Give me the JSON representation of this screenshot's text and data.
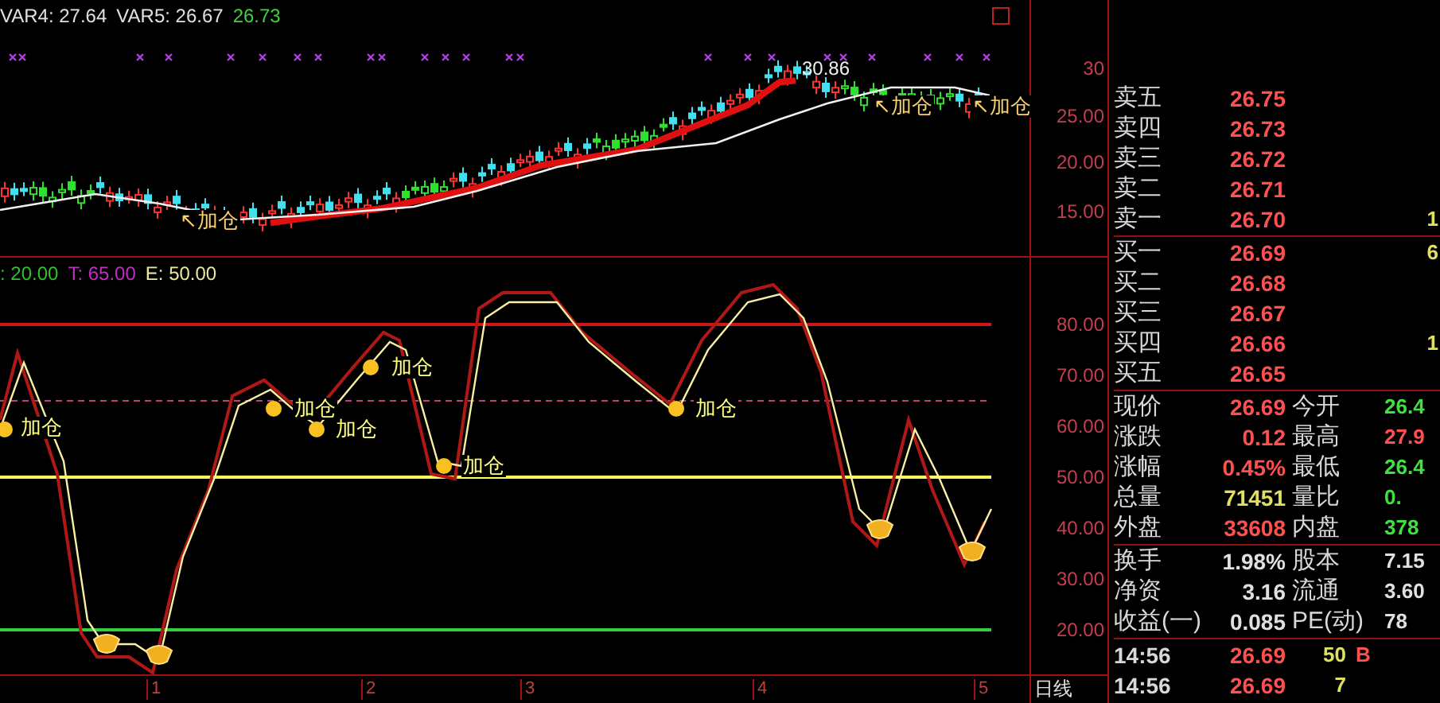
{
  "upper_chart": {
    "legend": [
      {
        "text": "VAR4: 27.64",
        "color": "#e0e0e0"
      },
      {
        "text": "VAR5: 26.67",
        "color": "#e0e0e0"
      },
      {
        "text": "26.73",
        "color": "#40d040"
      }
    ],
    "signals": [
      {
        "label": "↖加仓"
      },
      {
        "label": "↖加仓"
      },
      {
        "label": "↖加仓"
      }
    ],
    "high_label": "30.86",
    "axis_labels": [
      "30",
      "25.00",
      "20.00",
      "15.00"
    ]
  },
  "lower_chart": {
    "legend": [
      {
        "text": ": 20.00",
        "color": "#30c030"
      },
      {
        "text": "T: 65.00",
        "color": "#c030c0"
      },
      {
        "text": "E: 50.00",
        "color": "#e8e8a0"
      }
    ],
    "signals": [
      {
        "label": "加仓"
      },
      {
        "label": "加仓"
      },
      {
        "label": "加仓"
      },
      {
        "label": "加仓"
      },
      {
        "label": "加仓"
      },
      {
        "label": "加仓"
      }
    ],
    "axis_labels": [
      "80.00",
      "70.00",
      "60.00",
      "50.00",
      "40.00",
      "30.00",
      "20.00"
    ]
  },
  "x_axis": {
    "labels": [
      "1",
      "2",
      "3",
      "4",
      "5"
    ],
    "period": "日线"
  },
  "order_book": {
    "asks": [
      {
        "label": "卖五",
        "price": "26.75"
      },
      {
        "label": "卖四",
        "price": "26.73"
      },
      {
        "label": "卖三",
        "price": "26.72"
      },
      {
        "label": "卖二",
        "price": "26.71"
      },
      {
        "label": "卖一",
        "price": "26.70",
        "volume": "1"
      }
    ],
    "bids": [
      {
        "label": "买一",
        "price": "26.69",
        "volume": "6"
      },
      {
        "label": "买二",
        "price": "26.68"
      },
      {
        "label": "买三",
        "price": "26.67"
      },
      {
        "label": "买四",
        "price": "26.66",
        "volume": "1"
      },
      {
        "label": "买五",
        "price": "26.65"
      }
    ]
  },
  "quote_stats": [
    {
      "label": "现价",
      "value": "26.69",
      "kind": "rise"
    },
    {
      "label": "今开",
      "value": "26.4",
      "kind": "fall"
    },
    {
      "label": "涨跌",
      "value": "0.12",
      "kind": "rise"
    },
    {
      "label": "最高",
      "value": "27.9",
      "kind": "rise"
    },
    {
      "label": "涨幅",
      "value": "0.45%",
      "kind": "rise"
    },
    {
      "label": "最低",
      "value": "26.4",
      "kind": "fall"
    },
    {
      "label": "总量",
      "value": "71451",
      "kind": "volume"
    },
    {
      "label": "量比",
      "value": "0.",
      "kind": "fall"
    },
    {
      "label": "外盘",
      "value": "33608",
      "kind": "rise"
    },
    {
      "label": "内盘",
      "value": "378",
      "kind": "fall"
    }
  ],
  "finance_stats": [
    {
      "label": "换手",
      "value": "1.98%",
      "kind": "flat"
    },
    {
      "label": "股本",
      "value": "7.15",
      "kind": "flat"
    },
    {
      "label": "净资",
      "value": "3.16",
      "kind": "flat"
    },
    {
      "label": "流通",
      "value": "3.60",
      "kind": "flat"
    },
    {
      "label": "收益(一)",
      "value": "0.085",
      "kind": "flat"
    },
    {
      "label": "PE(动)",
      "value": "78",
      "kind": "flat"
    }
  ],
  "ticks": [
    {
      "time": "14:56",
      "price": "26.69",
      "volume": "50",
      "side": "B"
    },
    {
      "time": "14:56",
      "price": "26.69",
      "volume": "7"
    }
  ]
}
